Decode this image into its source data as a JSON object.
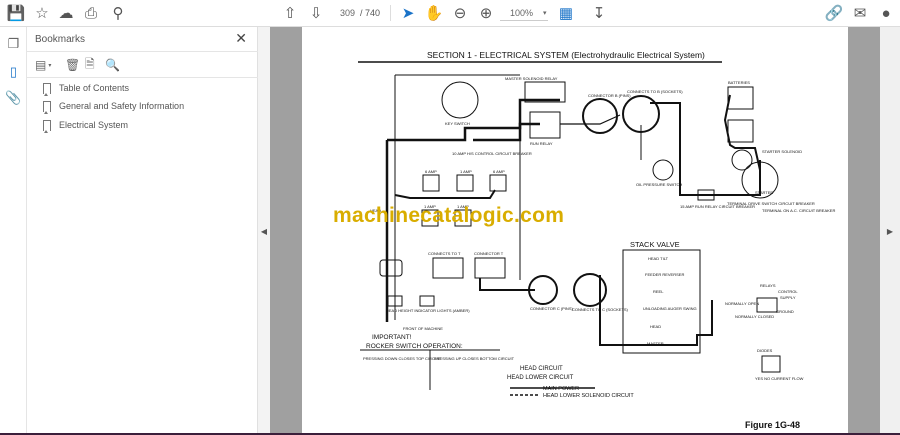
{
  "toolbar": {
    "page_current": "309",
    "page_total": "/ 740",
    "zoom": "100%"
  },
  "bookmarks": {
    "title": "Bookmarks",
    "items": [
      {
        "label": "Table of Contents"
      },
      {
        "label": "General and Safety Information"
      },
      {
        "label": "Electrical System"
      }
    ]
  },
  "document": {
    "title": "SECTION 1 - ELECTRICAL SYSTEM (Electrohydraulic Electrical System)",
    "watermark": "machinecatalogic.com",
    "figure": "Figure 1G-48",
    "labels": {
      "master_relay": "MASTER SOLENOID RELAY",
      "key_switch": "KEY SWITCH",
      "breaker10": "10 AMP H/S CONTROL CIRCUIT BREAKER",
      "run_relay": "RUN RELAY",
      "connector_b": "CONNECTOR B (PINS)",
      "connects_b": "CONNECTS TO B (SOCKETS)",
      "oil_switch": "OIL PRESSURE SWITCH",
      "batteries": "BATTERIES",
      "starter_solenoid": "STARTER SOLENOID",
      "starter": "STARTER",
      "breaker15": "15 AMP RUN RELAY CIRCUIT BREAKER",
      "terminal_drive": "TERMINAL DRIVE SWITCH CIRCUIT BREAKER",
      "terminal_ac": "TERMINAL ON A.C. CIRCUIT BREAKER",
      "amp6a": "6 AMP",
      "amp1a": "1 AMP",
      "amp6b": "6 AMP",
      "amp1b": "1 AMP",
      "amp1c": "1 AMP",
      "head": "HEAD",
      "stack_valve": "STACK VALVE",
      "sv_head_tilt": "HEAD TILT",
      "sv_feeder": "FEEDER REVERSER",
      "sv_reel": "REEL",
      "sv_unloading": "UNLOADING AUGER SWING",
      "sv_head": "HEAD",
      "sv_master": "MASTER",
      "connects_t": "CONNECTS TO T",
      "connector_t": "CONNECTOR T",
      "connector_c": "CONNECTOR C (PINS)",
      "connects_c": "CONNECTS TO C (SOCKETS)",
      "head_lights": "HEAD HEIGHT INDICATOR LIGHTS (AMBER)",
      "front": "FRONT OF MACHINE",
      "important": "IMPORTANT!",
      "rocker": "ROCKER SWITCH OPERATION:",
      "press_down": "PRESSING DOWN CLOSES TOP CIRCUIT",
      "press_up": "PRESSING UP CLOSES BOTTOM CIRCUIT",
      "head_circuit": "HEAD CIRCUIT",
      "head_lower": "HEAD LOWER CIRCUIT",
      "main_power": "MAIN POWER",
      "solenoid_circuit": "HEAD LOWER SOLENOID CIRCUIT",
      "relays": "RELAYS",
      "relay_control": "CONTROL",
      "relay_supply": "SUPPLY",
      "relay_ground": "GROUND",
      "relay_open": "NORMALLY OPEN",
      "relay_closed": "NORMALLY CLOSED",
      "diodes": "DIODES",
      "diode_flow": "YES  NO CURRENT FLOW"
    }
  }
}
